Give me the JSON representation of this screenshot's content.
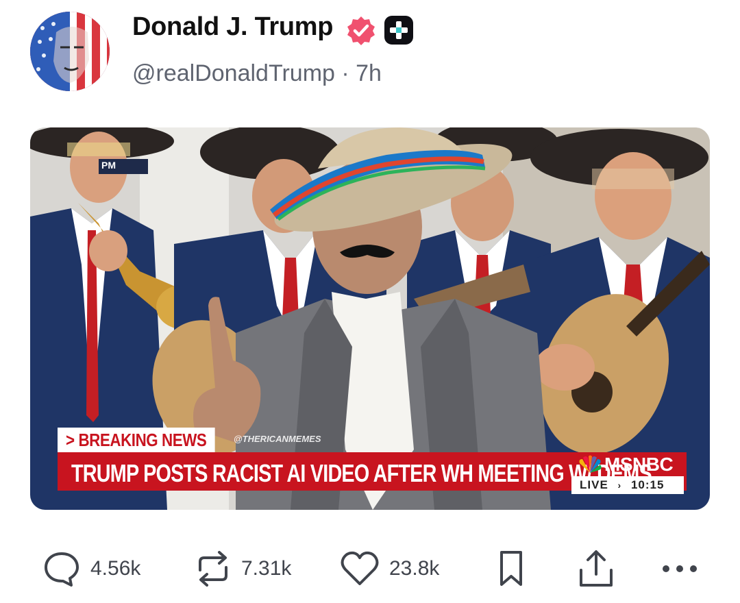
{
  "post": {
    "author_name": "Donald J. Trump",
    "handle": "@realDonaldTrump",
    "separator": "·",
    "time": "7h",
    "handle_line": "@realDonaldTrump · 7h"
  },
  "media": {
    "ticker_tag": "> BREAKING NEWS",
    "watermark": "@THERICANMEMES",
    "headline": "TRUMP POSTS RACIST AI VIDEO AFTER WH MEETING W/ DEMS",
    "network": "MSNBC",
    "live_label": "LIVE",
    "clock": "10:15",
    "corner_text": "PM"
  },
  "actions": {
    "replies": "4.56k",
    "reposts": "7.31k",
    "likes": "23.8k"
  },
  "colors": {
    "verified": "#f0516f",
    "breaking_red": "#c8141f",
    "text_secondary": "#5f6470"
  },
  "icons": [
    "reply-icon",
    "repost-icon",
    "like-icon",
    "bookmark-icon",
    "share-icon",
    "more-icon",
    "verified-icon",
    "plus-badge-icon"
  ]
}
